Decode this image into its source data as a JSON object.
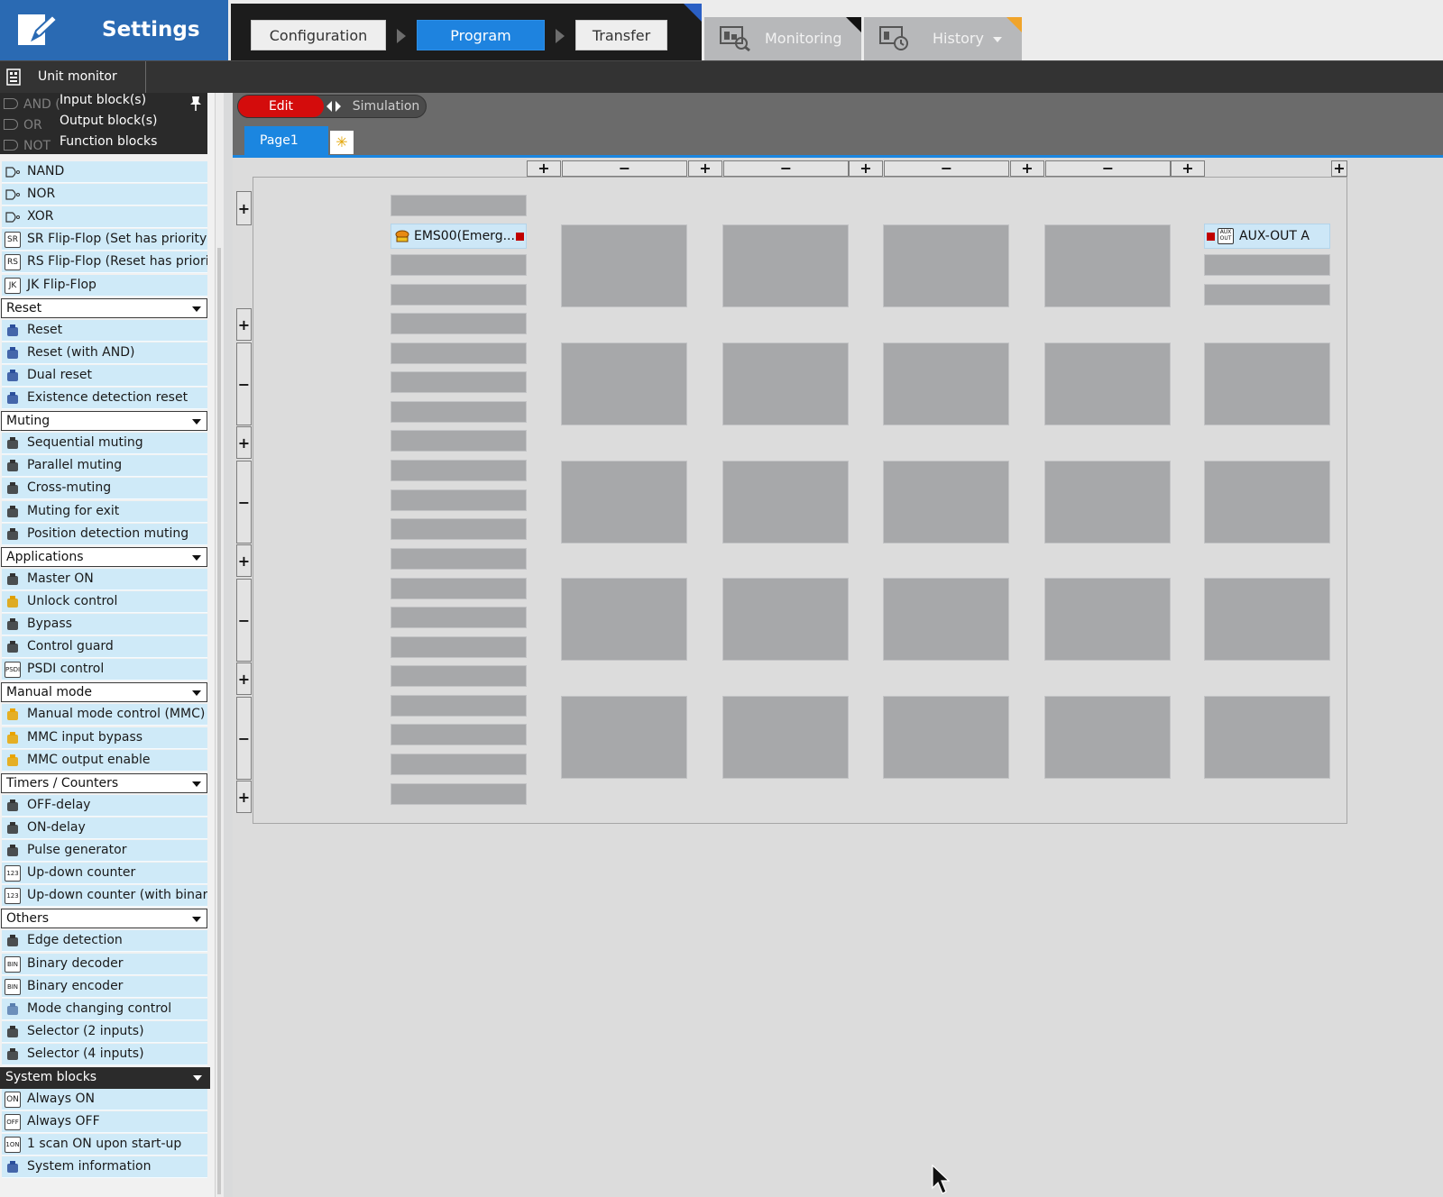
{
  "header": {
    "settings_label": "Settings",
    "steps": [
      {
        "label": "Configuration",
        "active": false
      },
      {
        "label": "Program",
        "active": true
      },
      {
        "label": "Transfer",
        "active": false
      }
    ],
    "tabs": [
      {
        "label": "Monitoring"
      },
      {
        "label": "History"
      }
    ]
  },
  "toolbar": {
    "unit_monitor_label": "Unit monitor"
  },
  "palette": {
    "overlay": {
      "faded_gates": [
        "AND (",
        "OR",
        "NOT"
      ],
      "menu_items": [
        "Input block(s)",
        "Output block(s)",
        "Function blocks"
      ]
    },
    "groups": [
      {
        "category": null,
        "items": [
          {
            "label": "NAND",
            "icon": "nand-gate-icon"
          },
          {
            "label": "NOR",
            "icon": "nor-gate-icon"
          },
          {
            "label": "XOR",
            "icon": "xor-gate-icon"
          },
          {
            "label": "SR Flip-Flop (Set has priority)",
            "icon": "sr-flipflop-icon"
          },
          {
            "label": "RS Flip-Flop (Reset has priori...",
            "icon": "rs-flipflop-icon"
          },
          {
            "label": "JK Flip-Flop",
            "icon": "jk-flipflop-icon"
          }
        ]
      },
      {
        "category": "Reset",
        "items": [
          {
            "label": "Reset",
            "icon": "reset-icon"
          },
          {
            "label": "Reset (with AND)",
            "icon": "reset-and-icon"
          },
          {
            "label": "Dual reset",
            "icon": "dual-reset-icon"
          },
          {
            "label": "Existence detection reset",
            "icon": "existence-reset-icon"
          }
        ]
      },
      {
        "category": "Muting",
        "items": [
          {
            "label": "Sequential muting",
            "icon": "sequential-muting-icon"
          },
          {
            "label": "Parallel muting",
            "icon": "parallel-muting-icon"
          },
          {
            "label": "Cross-muting",
            "icon": "cross-muting-icon"
          },
          {
            "label": "Muting for exit",
            "icon": "muting-exit-icon"
          },
          {
            "label": "Position detection muting",
            "icon": "position-muting-icon"
          }
        ]
      },
      {
        "category": "Applications",
        "items": [
          {
            "label": "Master ON",
            "icon": "master-on-icon"
          },
          {
            "label": "Unlock control",
            "icon": "unlock-icon"
          },
          {
            "label": "Bypass",
            "icon": "bypass-icon"
          },
          {
            "label": "Control guard",
            "icon": "control-guard-icon"
          },
          {
            "label": "PSDI control",
            "icon": "psdi-icon"
          }
        ]
      },
      {
        "category": "Manual mode",
        "items": [
          {
            "label": "Manual mode control (MMC)",
            "icon": "mmc-icon"
          },
          {
            "label": "MMC input bypass",
            "icon": "mmc-bypass-icon"
          },
          {
            "label": "MMC output enable",
            "icon": "mmc-output-icon"
          }
        ]
      },
      {
        "category": "Timers / Counters",
        "items": [
          {
            "label": "OFF-delay",
            "icon": "off-delay-icon"
          },
          {
            "label": "ON-delay",
            "icon": "on-delay-icon"
          },
          {
            "label": "Pulse generator",
            "icon": "pulse-icon"
          },
          {
            "label": "Up-down counter",
            "icon": "counter-icon"
          },
          {
            "label": "Up-down counter (with binar...",
            "icon": "binary-counter-icon"
          }
        ]
      },
      {
        "category": "Others",
        "items": [
          {
            "label": "Edge detection",
            "icon": "edge-icon"
          },
          {
            "label": "Binary decoder",
            "icon": "binary-decoder-icon"
          },
          {
            "label": "Binary encoder",
            "icon": "binary-encoder-icon"
          },
          {
            "label": "Mode changing control",
            "icon": "mode-change-icon"
          },
          {
            "label": "Selector (2 inputs)",
            "icon": "selector-2-icon"
          },
          {
            "label": "Selector (4 inputs)",
            "icon": "selector-4-icon"
          }
        ]
      }
    ],
    "system_blocks": {
      "category": "System blocks",
      "items": [
        {
          "label": "Always ON",
          "icon": "always-on-icon"
        },
        {
          "label": "Always OFF",
          "icon": "always-off-icon"
        },
        {
          "label": "1 scan ON upon start-up",
          "icon": "one-scan-icon"
        },
        {
          "label": "System information",
          "icon": "system-info-icon"
        }
      ]
    }
  },
  "editor": {
    "mode_edit": "Edit",
    "mode_simulation": "Simulation",
    "page_tab": "Page1",
    "input_block": "EMS00(Emerg....",
    "output_block": "AUX-OUT A",
    "colors": {
      "edit_red": "#d40c0c",
      "program_blue": "#1e83df",
      "slot_gray": "#a7a8aa",
      "block_blue": "#cde7f7"
    }
  }
}
